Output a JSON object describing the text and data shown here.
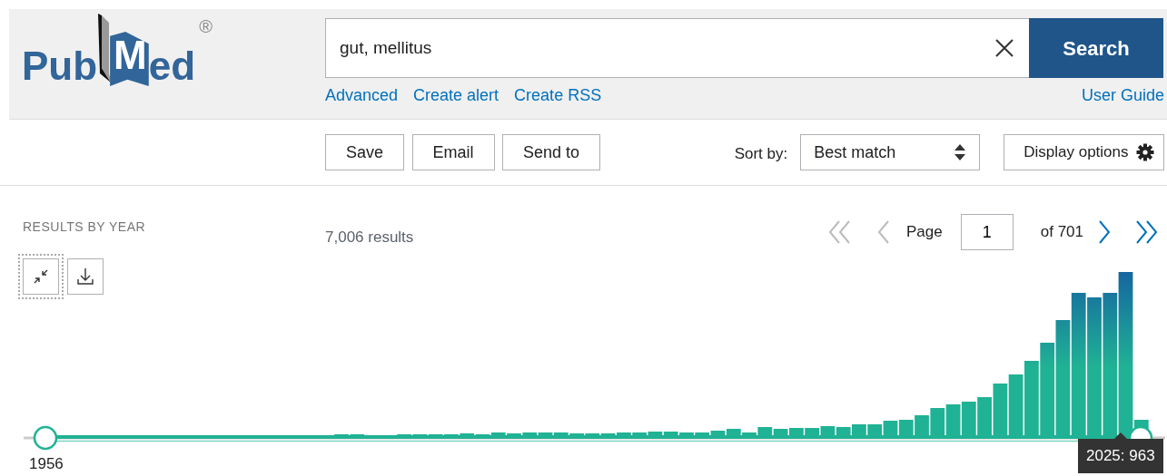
{
  "logo": {
    "parts": [
      "Pub",
      "M",
      "ed"
    ],
    "mark": "®"
  },
  "search": {
    "value": "gut, mellitus",
    "button": "Search"
  },
  "links": [
    "Advanced",
    "Create alert",
    "Create RSS"
  ],
  "user_guide": "User Guide",
  "actions": [
    "Save",
    "Email",
    "Send to"
  ],
  "sort": {
    "label": "Sort by:",
    "value": "Best match"
  },
  "display_options": "Display options",
  "timeline": {
    "title": "RESULTS BY YEAR",
    "start_year": "1956",
    "tooltip": "2025: 963",
    "handles": [
      {
        "level": 0
      },
      {
        "level": 1
      }
    ]
  },
  "results": {
    "count": "7,006 results"
  },
  "pagination": {
    "label": "Page",
    "page": "1",
    "of": "of 701"
  }
}
